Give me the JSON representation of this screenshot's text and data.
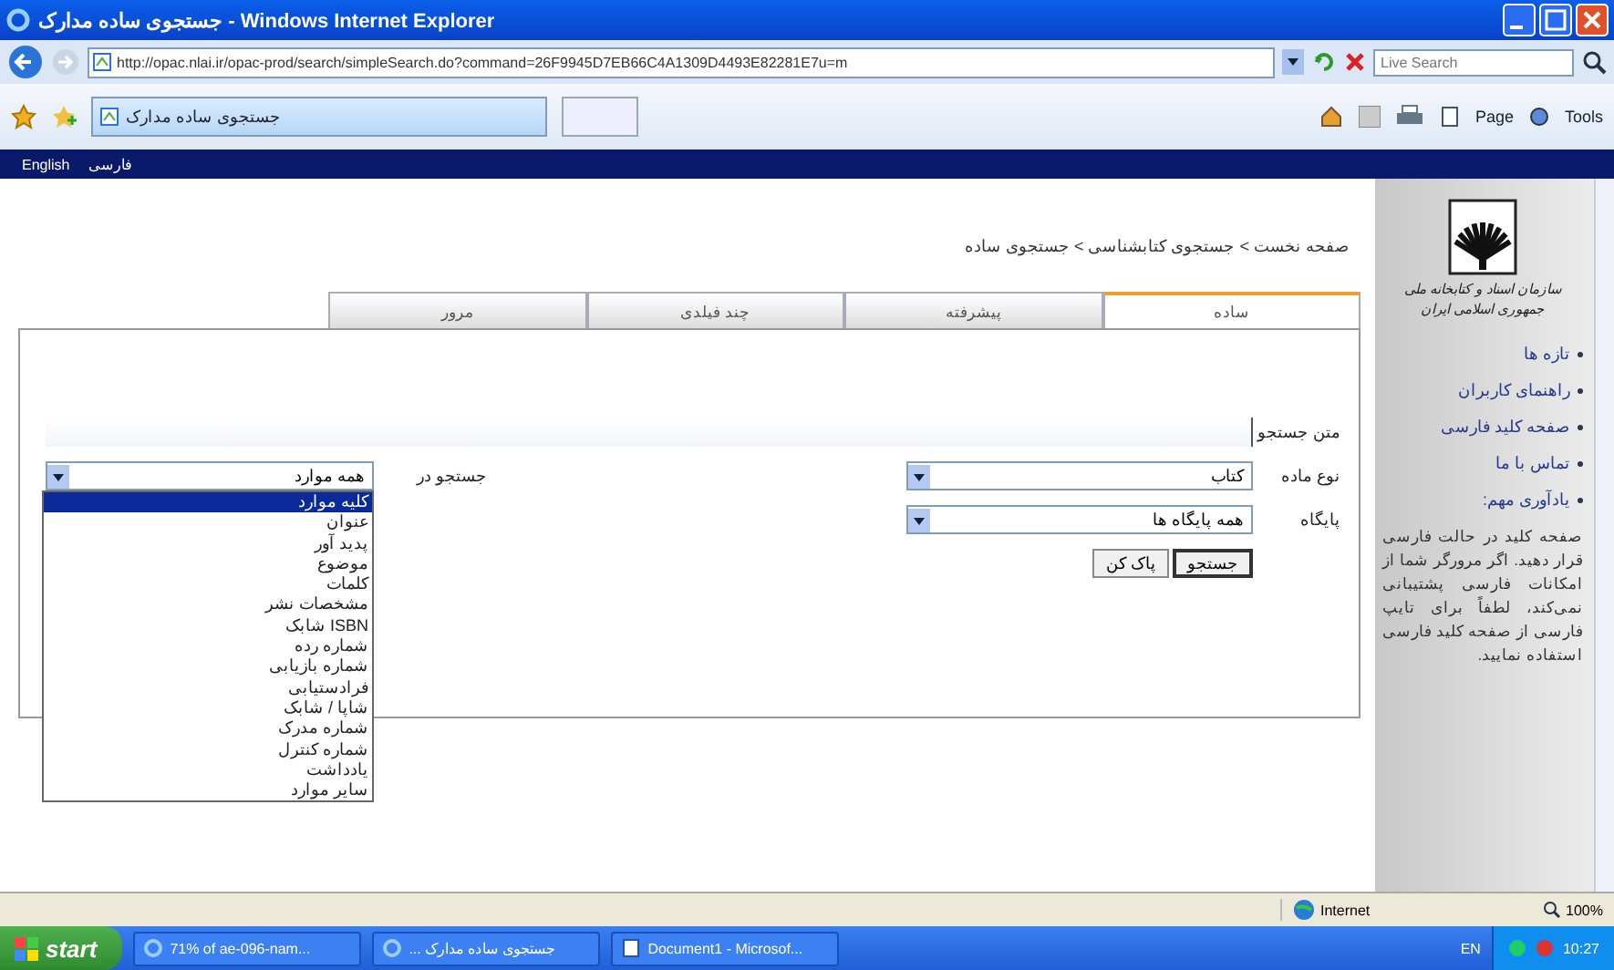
{
  "window": {
    "title": "جستجوی ساده مدارک - Windows Internet Explorer"
  },
  "address_bar": {
    "url": "http://opac.nlai.ir/opac-prod/search/simpleSearch.do?command=26F9945D7EB66C4A1309D4493E82281E7u=m",
    "search_placeholder": "Live Search"
  },
  "browser_tab": {
    "title": "جستجوی ساده مدارک"
  },
  "command_bar": {
    "page_menu": "Page",
    "tools_menu": "Tools"
  },
  "site_nav": {
    "english_link": "English",
    "farsi_link": "فارسی"
  },
  "breadcrumb": "صفحه نخست > جستجوی کتابشناسی > جستجوی ساده",
  "tabs": [
    {
      "label": "ساده",
      "selected": true
    },
    {
      "label": "پیشرفته",
      "selected": false
    },
    {
      "label": "چند فیلدی",
      "selected": false
    },
    {
      "label": "مرور",
      "selected": false
    }
  ],
  "form": {
    "search_text": {
      "label": "متن جستجو"
    },
    "material": {
      "label": "نوع ماده",
      "value": "کتاب"
    },
    "database": {
      "label": "پایگاه",
      "value": "همه پایگاه ها"
    },
    "search_in": {
      "label": "جستجو در",
      "value": "همه موارد",
      "expanded": true,
      "options": [
        {
          "label": "کلیه موارد",
          "selected": true
        },
        {
          "label": "عنوان",
          "selected": false
        },
        {
          "label": "پدید آور",
          "selected": false
        },
        {
          "label": "موضوع",
          "selected": false
        },
        {
          "label": "کلمات",
          "selected": false
        },
        {
          "label": "مشخصات نشر",
          "selected": false
        },
        {
          "label": "ISBN شابک",
          "selected": false
        },
        {
          "label": "شماره رده",
          "selected": false
        },
        {
          "label": "شماره بازیابی",
          "selected": false
        },
        {
          "label": "فرادستیابی",
          "selected": false
        },
        {
          "label": "شاپا / شابک",
          "selected": false
        },
        {
          "label": "شماره مدرک",
          "selected": false
        },
        {
          "label": "شماره کنترل",
          "selected": false
        },
        {
          "label": "یادداشت",
          "selected": false
        },
        {
          "label": "سایر موارد",
          "selected": false
        }
      ]
    },
    "buttons": [
      "جستجو",
      "پاک کن"
    ]
  },
  "sidebar": {
    "logo_text": [
      "سازمان اسناد و کتابخانه ملی",
      "جمهوری اسلامی ایران"
    ],
    "links": [
      "تازه ها",
      "راهنمای کاربران",
      "صفحه کلید فارسی",
      "تماس با ما",
      "یادآوری مهم:"
    ],
    "note": "صفحه کلید در حالت فارسی قرار دهید. اگر مرورگر شما از امکانات فارسی پشتیبانی نمی‌کند، لطفاً برای تایپ فارسی از صفحه کلید فارسی استفاده نمایید."
  },
  "status_bar": {
    "zone": "Internet",
    "zoom": "100%"
  },
  "taskbar": {
    "start": "start",
    "download_task": "71% of ae-096-nam...",
    "browser_task": "جستجوی ساده مدارک ...",
    "document_task": "Document1 - Microsof...",
    "language": "EN",
    "clock": "10:27"
  }
}
